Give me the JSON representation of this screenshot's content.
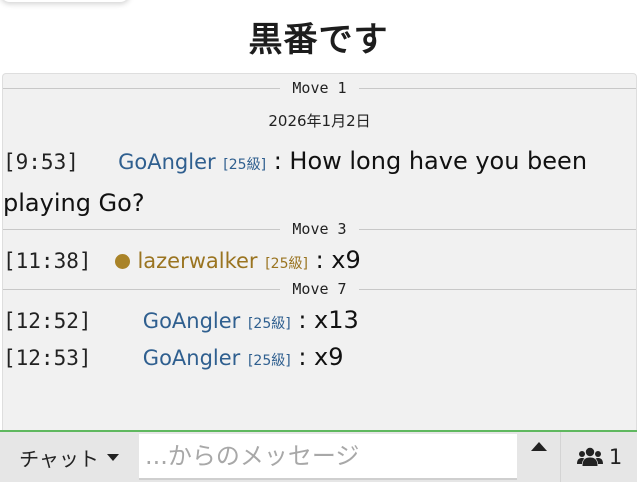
{
  "page_title": "黒番です",
  "chat": {
    "separators": [
      {
        "label": "Move 1"
      },
      {
        "label": "Move 3"
      },
      {
        "label": "Move 7"
      }
    ],
    "date": "2026年1月2日",
    "messages": [
      {
        "time": "[9:53]",
        "user": "GoAngler",
        "rank": "[25級]",
        "text": ": How long have you been playing Go?"
      },
      {
        "time": "[11:38]",
        "user": "lazerwalker",
        "rank": "[25級]",
        "text": ": x9",
        "status_color": "#a98328"
      },
      {
        "time": "[12:52]",
        "user": "GoAngler",
        "rank": "[25級]",
        "text": ": x13"
      },
      {
        "time": "[12:53]",
        "user": "GoAngler",
        "rank": "[25級]",
        "text": ": x9"
      }
    ]
  },
  "input_bar": {
    "channel_label": "チャット",
    "placeholder": "...からのメッセージ",
    "user_count": "1",
    "accent_color": "#5fb85f"
  },
  "icons": {
    "channel_dropdown": "caret-down-icon",
    "scroll_up": "caret-up-icon",
    "users": "users-icon"
  }
}
